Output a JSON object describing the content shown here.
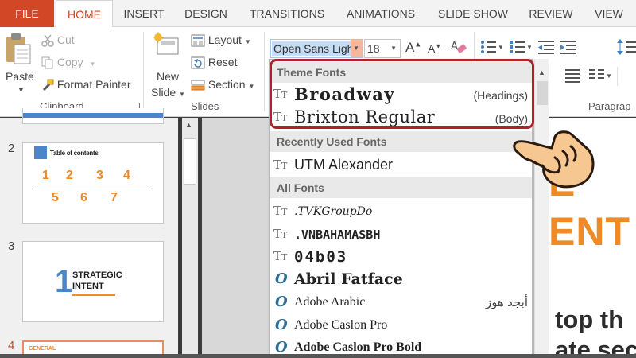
{
  "tabs": [
    "FILE",
    "HOME",
    "INSERT",
    "DESIGN",
    "TRANSITIONS",
    "ANIMATIONS",
    "SLIDE SHOW",
    "REVIEW",
    "VIEW"
  ],
  "clipboard": {
    "paste": "Paste",
    "cut": "Cut",
    "copy": "Copy",
    "format_painter": "Format Painter",
    "group_label": "Clipboard"
  },
  "slides_group": {
    "new_slide_line1": "New",
    "new_slide_line2": "Slide",
    "layout": "Layout",
    "reset": "Reset",
    "section": "Section",
    "group_label": "Slides"
  },
  "font": {
    "name": "Open Sans Ligh",
    "size": "18"
  },
  "paragraph_label": "Paragrap",
  "dropdown": {
    "theme_header": "Theme Fonts",
    "theme_fonts": [
      {
        "name": "Broadway",
        "role": "(Headings)"
      },
      {
        "name": "Brixton Regular",
        "role": "(Body)"
      }
    ],
    "recent_header": "Recently Used Fonts",
    "recent_fonts": [
      {
        "name": "UTM Alexander"
      }
    ],
    "all_header": "All Fonts",
    "all_fonts": [
      {
        "name": ".TVKGroupDo",
        "icon": "truetype-icon"
      },
      {
        "name": ".VNBAHAMASBH",
        "icon": "truetype-icon"
      },
      {
        "name": "04b03",
        "icon": "truetype-icon"
      },
      {
        "name": "Abril Fatface",
        "icon": "opentype-icon"
      },
      {
        "name": "Adobe Arabic",
        "sample": "أبجد هوز",
        "icon": "opentype-icon"
      },
      {
        "name": "Adobe Caslon Pro",
        "icon": "opentype-icon"
      },
      {
        "name": "Adobe Caslon Pro Bold",
        "icon": "opentype-icon"
      }
    ]
  },
  "slides": [
    {
      "number": "2",
      "title": "Table of contents",
      "items": [
        "1",
        "2",
        "3",
        "4",
        "5",
        "6",
        "7"
      ]
    },
    {
      "number": "3",
      "big_number": "1",
      "line1": "STRATEGIC",
      "line2": "INTENT"
    },
    {
      "number": "4",
      "label": "GENERAL"
    }
  ],
  "canvas": {
    "word1": "E",
    "word2": "ENT",
    "text1": "top th",
    "text2": "ate sec"
  },
  "colors": {
    "accent": "#d24726",
    "highlight": "#b3202a",
    "orange": "#f08a24",
    "blue": "#4a86c8"
  }
}
